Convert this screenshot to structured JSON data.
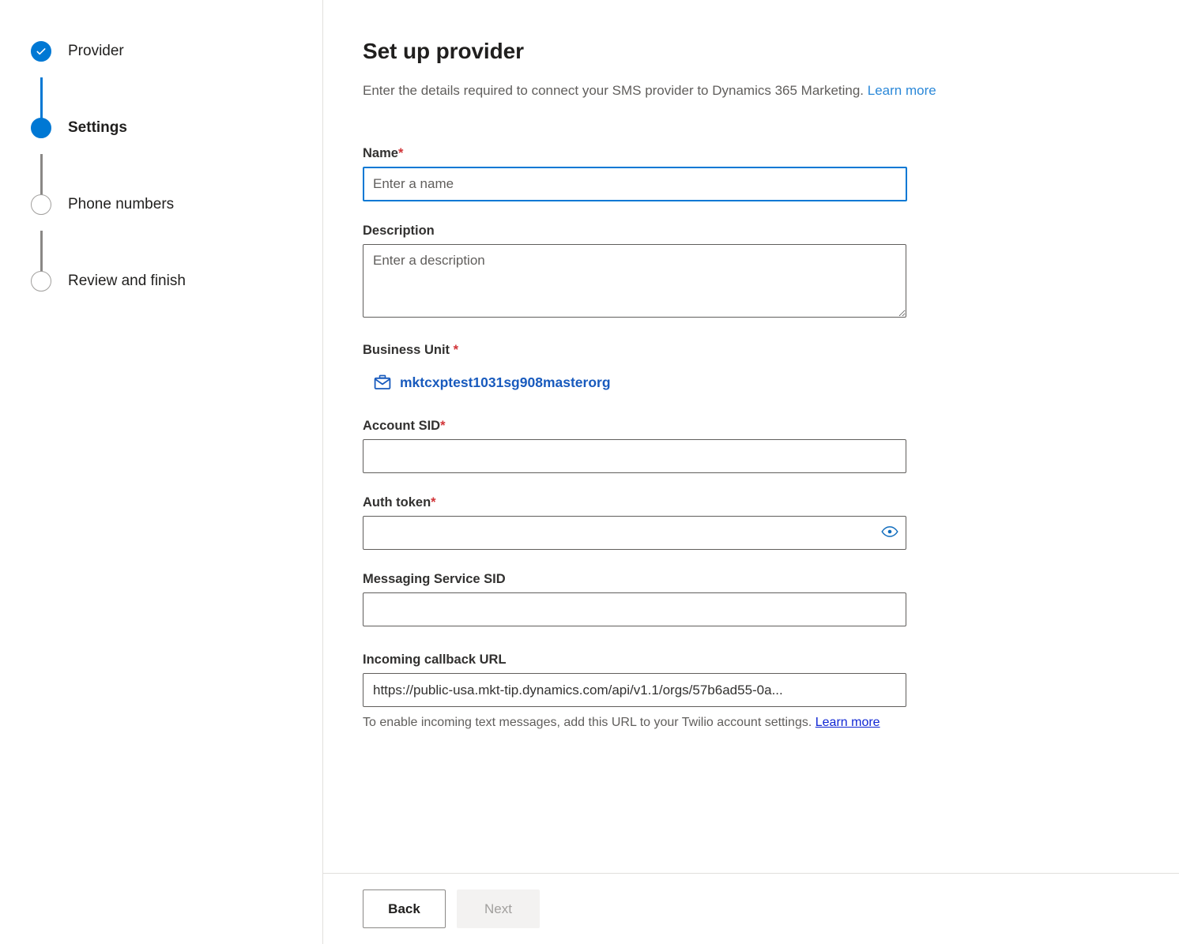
{
  "stepper": {
    "steps": [
      {
        "label": "Provider",
        "state": "done",
        "icon": "check-icon"
      },
      {
        "label": "Settings",
        "state": "current",
        "icon": "filled-circle-icon"
      },
      {
        "label": "Phone numbers",
        "state": "todo",
        "icon": "empty-circle-icon"
      },
      {
        "label": "Review and finish",
        "state": "todo",
        "icon": "empty-circle-icon"
      }
    ]
  },
  "header": {
    "title": "Set up provider",
    "subtitle": "Enter the details required to connect your SMS provider to Dynamics 365 Marketing.",
    "subtitle_link": "Learn more"
  },
  "form": {
    "name": {
      "label": "Name",
      "required_marker": "*",
      "placeholder": "Enter a name",
      "value": "",
      "focused": true
    },
    "description": {
      "label": "Description",
      "placeholder": "Enter a description",
      "value": ""
    },
    "business_unit": {
      "label": "Business Unit ",
      "required_marker": "*",
      "icon": "briefcase-icon",
      "value": "mktcxptest1031sg908masterorg"
    },
    "account_sid": {
      "label": "Account SID",
      "required_marker": "*",
      "placeholder": "",
      "value": ""
    },
    "auth_token": {
      "label": "Auth token",
      "required_marker": "*",
      "placeholder": "",
      "value": "",
      "reveal_icon": "eye-icon"
    },
    "messaging_service_sid": {
      "label": "Messaging Service SID",
      "placeholder": "",
      "value": ""
    },
    "incoming_callback_url": {
      "label": "Incoming callback URL",
      "value": "https://public-usa.mkt-tip.dynamics.com/api/v1.1/orgs/57b6ad55-0a...",
      "helper_text": "To enable incoming text messages, add this URL to your Twilio account settings. ",
      "helper_link": "Learn more"
    }
  },
  "footer": {
    "back_label": "Back",
    "next_label": "Next"
  },
  "colors": {
    "accent": "#0078d4",
    "link": "#2b88d8",
    "lookup_link": "#185abd",
    "helper_link": "#0f26d4",
    "required": "#d13438",
    "inactive_step": "#a19f9d",
    "connector_gray": "#8a8886"
  }
}
